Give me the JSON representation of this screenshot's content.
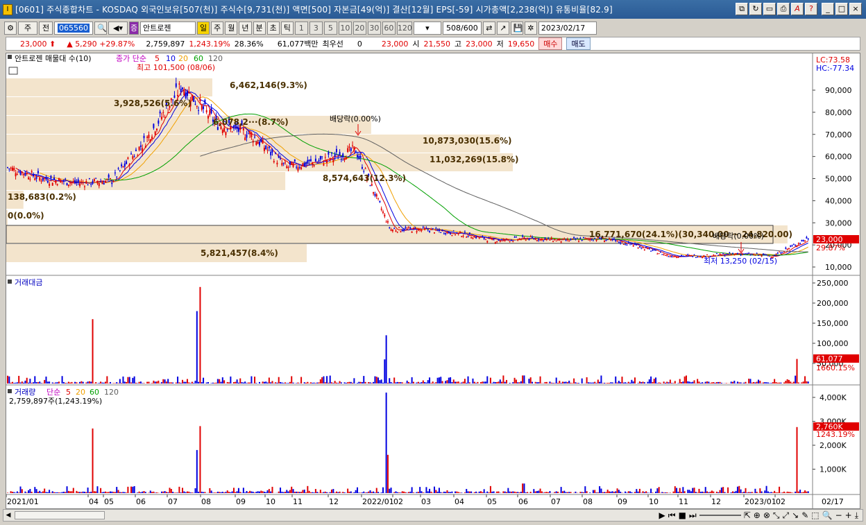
{
  "window": {
    "title": "[0601] 주식종합차트 - KOSDAQ 외국인보유[507(천)] 주식수[9,731(천)] 액면[500] 자본금[49(억)] 결산[12월] EPS[-59] 시가총액[2,238(억)] 유통비율[82.9]",
    "icon": "chart-app-icon",
    "buttons": [
      "restore-icon",
      "refresh-icon",
      "window-icon",
      "print-icon",
      "font-icon",
      "help-icon",
      "minimize-icon",
      "maximize-icon",
      "close-icon"
    ]
  },
  "toolbar": {
    "market": "주",
    "prev": "전",
    "code": "065560",
    "stock_name": "안트로젠",
    "tab_jung": "증",
    "periods": [
      "일",
      "주",
      "월",
      "년",
      "분",
      "초",
      "틱"
    ],
    "intervals": [
      "1",
      "3",
      "5",
      "10",
      "20",
      "30",
      "60",
      "120"
    ],
    "count": "508",
    "count_total": "/600",
    "date": "2023/02/17"
  },
  "pricebar": {
    "price": "23,000",
    "change": "5,290",
    "change_pct": "+29.87%",
    "volume": "2,759,897",
    "volume_ratio": "1,243.19%",
    "turnover": "28.36%",
    "amount": "61,077백만",
    "priority_label": "최우선",
    "priority_value": "0",
    "ask": "23,000",
    "open_label": "시",
    "open": "21,550",
    "high_label": "고",
    "high": "23,000",
    "low_label": "저",
    "low": "19,650",
    "buy": "매수",
    "sell": "매도"
  },
  "price_panel": {
    "title": "안트로젠 매물대 수(10)",
    "ma_label": "종가 단순",
    "ma_periods": [
      "5",
      "10",
      "20",
      "60",
      "120"
    ],
    "ma_colors": [
      "#e00000",
      "#0000e0",
      "#f0a000",
      "#00a000",
      "#808080"
    ],
    "lc": "LC:73.58",
    "hc": "HC:-77.34",
    "high_marker": "최고 101,500 (08/06)",
    "low_marker": "최저 13,250 (02/15)",
    "dividend1": "배당락(0.00%)",
    "dividend2": "배당락(0.00%)",
    "current_price": "23,000",
    "current_pct": "29.87%",
    "y_ticks": [
      "90,000",
      "80,000",
      "70,000",
      "60,000",
      "50,000",
      "40,000",
      "30,000",
      "20,000",
      "10,000"
    ],
    "profile_labels": [
      "6,462,146(9.3%)",
      "3,928,526(5.6%)",
      "6,078,2···(8.7%)",
      "10,873,030(15.6%)",
      "11,032,269(15.8%)",
      "8,574,643(12.3%)",
      "138,683(0.2%)",
      "0(0.0%)",
      "16,771,670(24.1%)(30,340.00 ~ 24,820.00)",
      "5,821,457(8.4%)"
    ]
  },
  "amount_panel": {
    "title": "거래대금",
    "y_ticks": [
      "250,000",
      "200,000",
      "150,000",
      "100,000",
      "50,000"
    ],
    "current": "61,077",
    "current_pct": "1660.15%"
  },
  "volume_panel": {
    "title": "거래량",
    "ma_label": "단순",
    "ma_periods": [
      "5",
      "20",
      "60",
      "120"
    ],
    "value": "2,759,897주(1,243.19%)",
    "y_ticks": [
      "4,000K",
      "3,000K",
      "2,000K",
      "1,000K"
    ],
    "current": "2,760K",
    "current_pct": "1243.19%"
  },
  "x_axis": {
    "ticks": [
      "2021/01",
      "04",
      "05",
      "06",
      "07",
      "08",
      "09",
      "10",
      "11",
      "12",
      "2022/01",
      "02",
      "03",
      "04",
      "05",
      "06",
      "07",
      "08",
      "09",
      "10",
      "11",
      "12",
      "2023/01",
      "02"
    ],
    "last_date": "02/17"
  },
  "chart_data": {
    "type": "candlestick",
    "x": [
      "2021/01",
      "04",
      "05",
      "06",
      "07",
      "08",
      "09",
      "10",
      "11",
      "12",
      "2022/01",
      "02",
      "03",
      "04",
      "05",
      "06",
      "07",
      "08",
      "09",
      "10",
      "11",
      "12",
      "2023/01",
      "02"
    ],
    "close_approx": [
      55000,
      50000,
      48000,
      49000,
      68000,
      92000,
      75000,
      70000,
      55000,
      58000,
      63000,
      27000,
      27000,
      25000,
      22000,
      23000,
      22000,
      23000,
      20000,
      15000,
      15000,
      16000,
      15000,
      23000
    ],
    "ylim": [
      10000,
      100000
    ]
  }
}
